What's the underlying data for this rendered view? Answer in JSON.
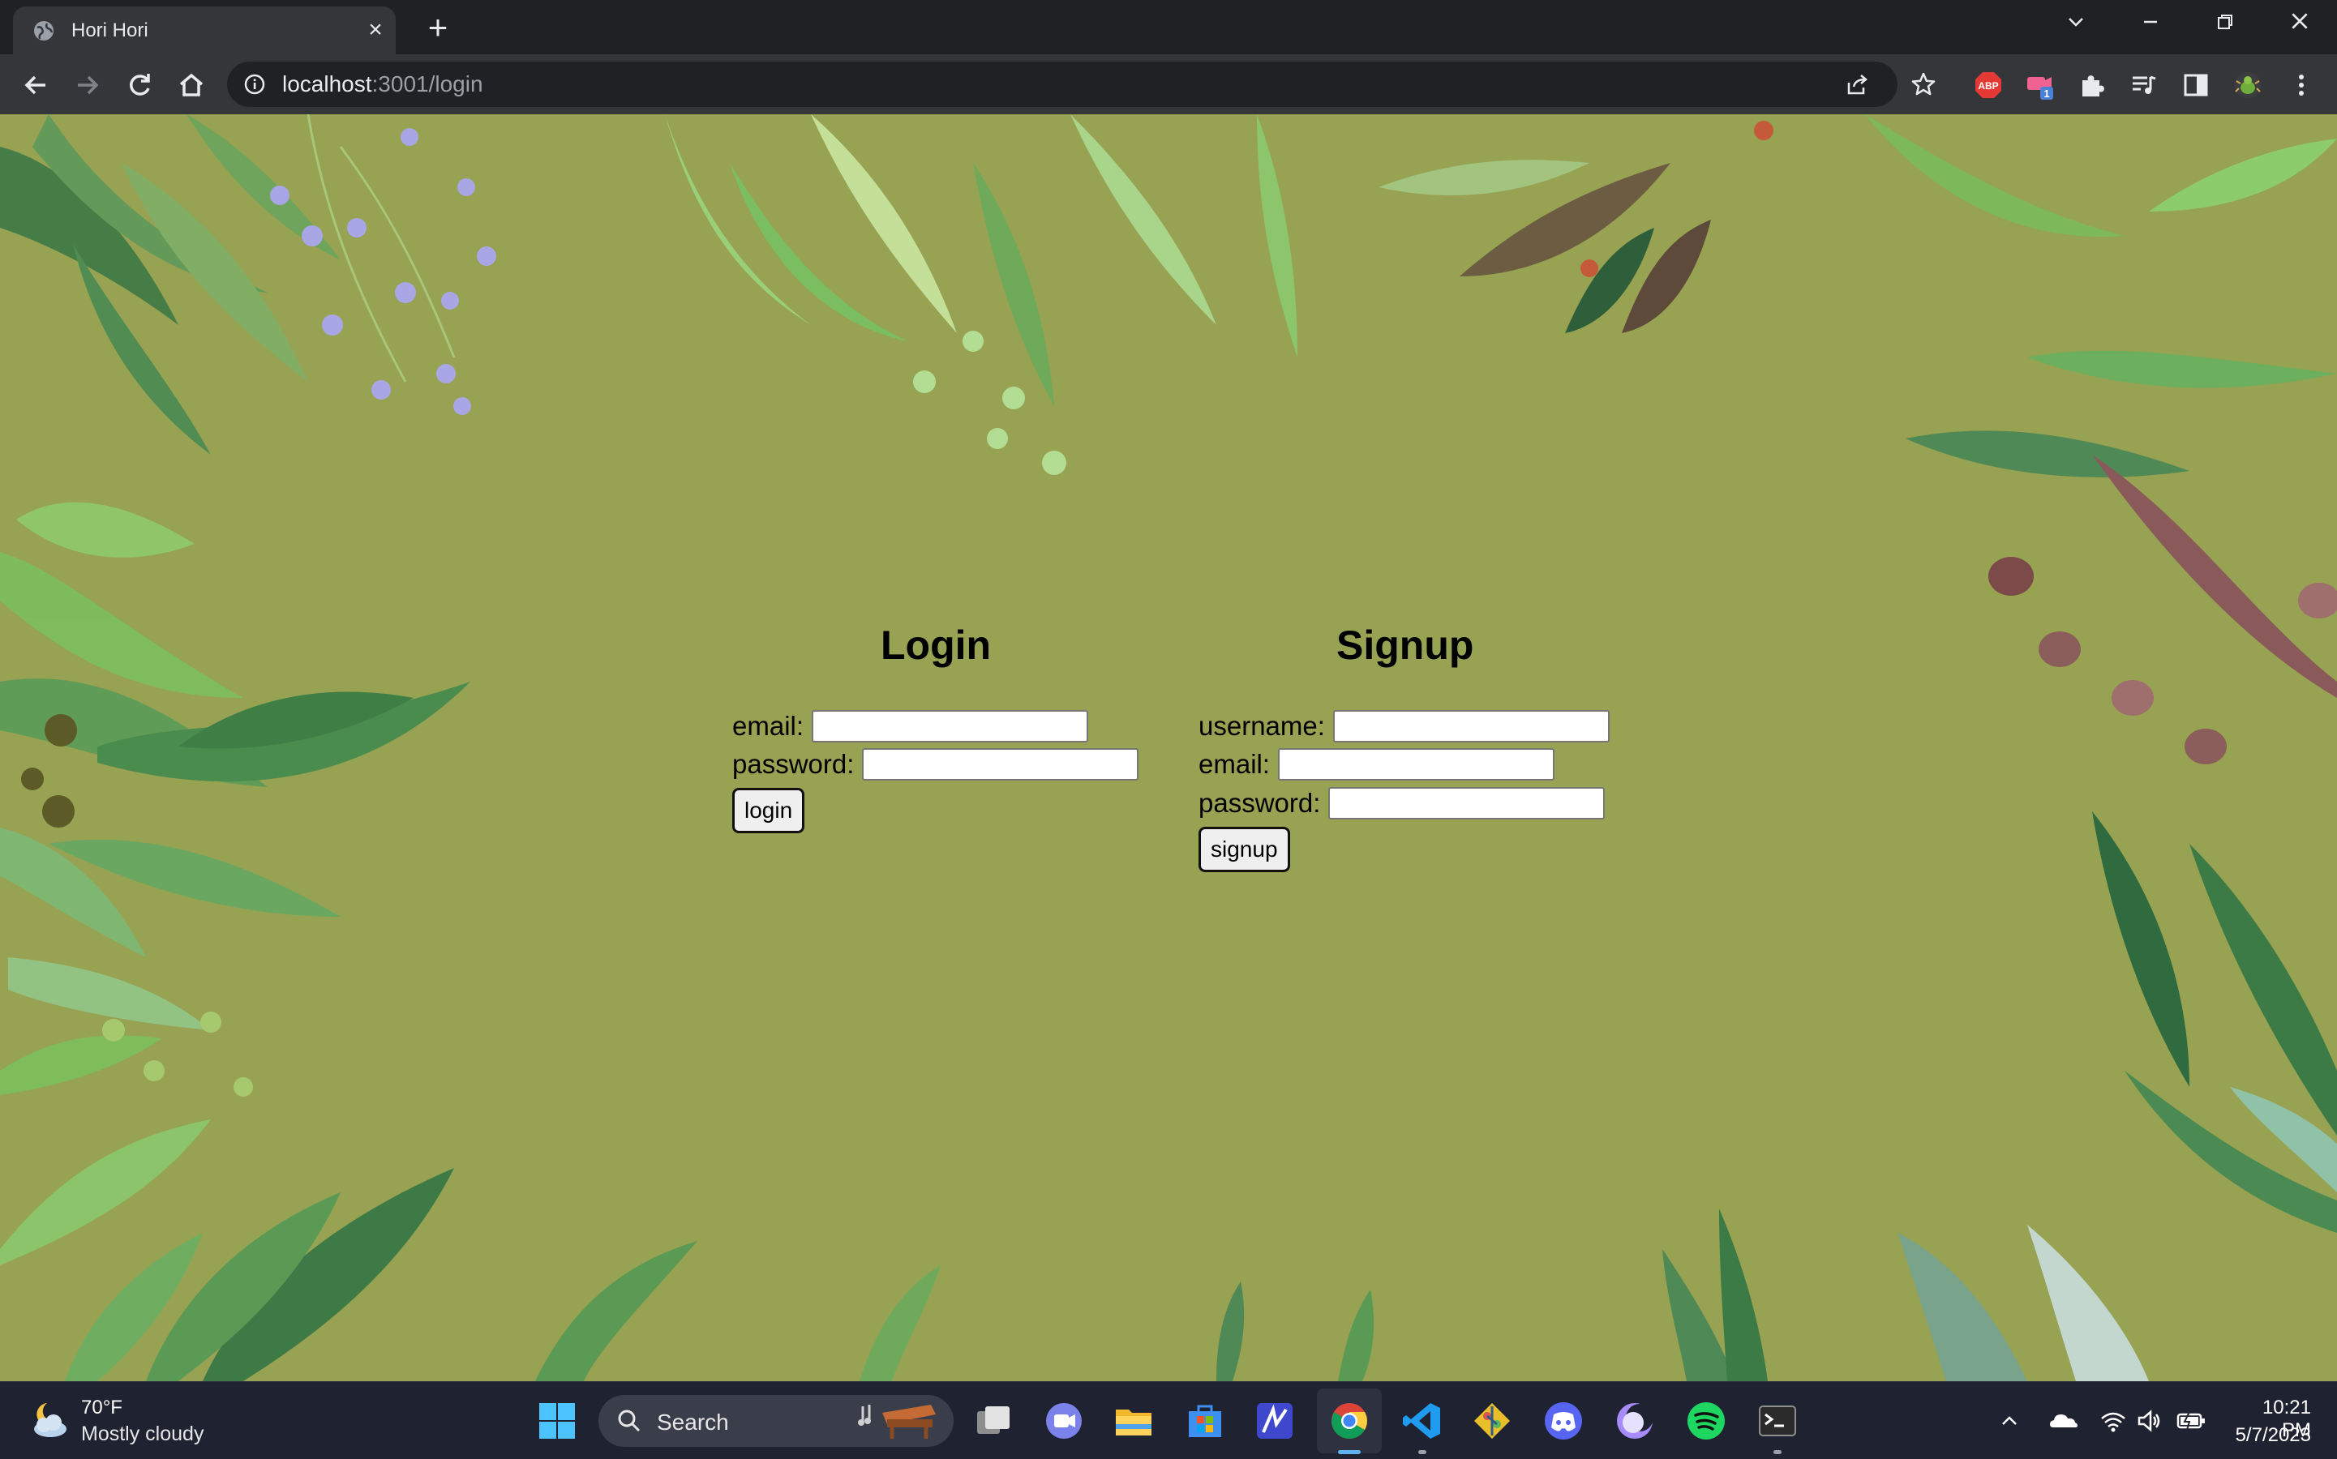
{
  "browser": {
    "tab_title": "Hori Hori",
    "url_host": "localhost",
    "url_path": ":3001/login",
    "extension_badge": "1",
    "abp_label": "ABP"
  },
  "login": {
    "heading": "Login",
    "email_label": "email:",
    "email_value": "",
    "password_label": "password:",
    "password_value": "",
    "button_label": "login"
  },
  "signup": {
    "heading": "Signup",
    "username_label": "username:",
    "username_value": "",
    "email_label": "email:",
    "email_value": "",
    "password_label": "password:",
    "password_value": "",
    "button_label": "signup"
  },
  "taskbar": {
    "weather_temp": "70°F",
    "weather_desc": "Mostly cloudy",
    "search_label": "Search",
    "time": "10:21 PM",
    "date": "5/7/2023"
  },
  "colors": {
    "page_background": "#97a252",
    "chrome_dark": "#202124",
    "toolbar": "#35363a",
    "taskbar": "#1f2230"
  }
}
